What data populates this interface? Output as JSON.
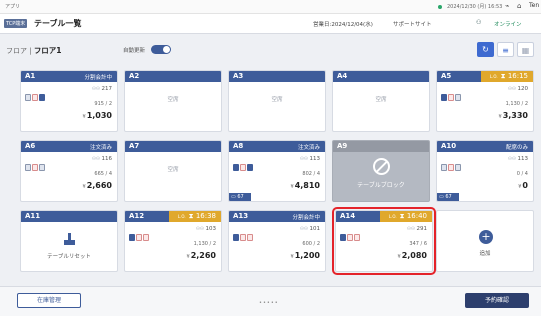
{
  "system_bar": {
    "app_name": "アプリ",
    "datetime": "2024/12/30 (月) 16:53",
    "brand": "Ten"
  },
  "header": {
    "badge": "TCP端末",
    "title": "テーブル一覧",
    "business_date": "営業日:2024/12/04(水)",
    "support": "サポートサイト",
    "online": "オンライン"
  },
  "floor": {
    "label": "フロア",
    "name": "フロア1",
    "auto_refresh_label": "自動更新",
    "auto_refresh": true
  },
  "tables": [
    {
      "name": "A1",
      "status": "分割会計中",
      "guests": "217",
      "sub": "915 / 2",
      "total": "1,030"
    },
    {
      "name": "A2",
      "empty_label": "空席"
    },
    {
      "name": "A3",
      "empty_label": "空席"
    },
    {
      "name": "A4",
      "empty_label": "空席"
    },
    {
      "name": "A5",
      "time_label": "L.O.",
      "time": "16:15",
      "guests": "120",
      "sub": "1,130 / 2",
      "total": "3,330"
    },
    {
      "name": "A6",
      "status": "注文済み",
      "guests": "116",
      "sub": "665 / 4",
      "total": "2,660"
    },
    {
      "name": "A7",
      "empty_label": "空席"
    },
    {
      "name": "A8",
      "status": "注文済み",
      "guests": "113",
      "sub": "802 / 4",
      "total": "4,810",
      "seat": "67"
    },
    {
      "name": "A9",
      "block_label": "テーブルブロック"
    },
    {
      "name": "A10",
      "status": "配席のみ",
      "guests": "113",
      "sub": "0 / 4",
      "total": "0",
      "seat": "67"
    },
    {
      "name": "A11",
      "reset_label": "テーブルリセット"
    },
    {
      "name": "A12",
      "time_label": "L.O.",
      "time": "16:38",
      "guests": "103",
      "sub": "1,130 / 2",
      "total": "2,260"
    },
    {
      "name": "A13",
      "status": "分割会計中",
      "guests": "101",
      "sub": "600 / 2",
      "total": "1,200"
    },
    {
      "name": "A14",
      "time_label": "L.O.",
      "time": "16:40",
      "guests": "291",
      "sub": "347 / 6",
      "total": "2,080"
    },
    {
      "add_label": "追加"
    }
  ],
  "footer": {
    "stock_button": "在庫管理",
    "pager": "•••••",
    "reservation_button": "予約確認"
  }
}
